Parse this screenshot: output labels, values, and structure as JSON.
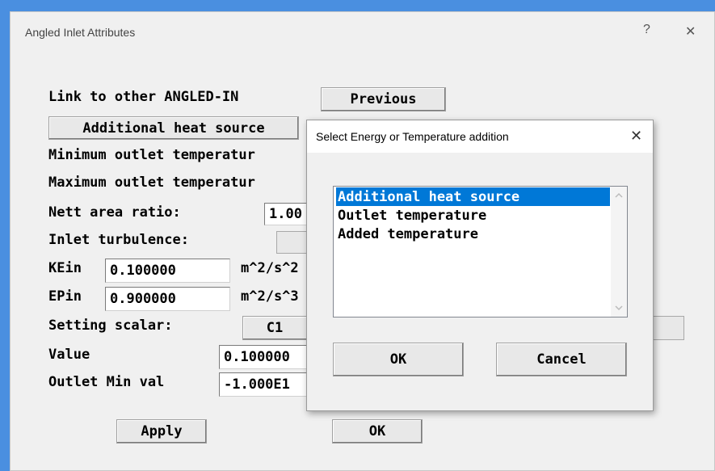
{
  "main_dialog": {
    "title": "Angled Inlet Attributes",
    "help_glyph": "?",
    "close_glyph": "✕",
    "link_label": "Link to other ANGLED-IN",
    "previous_button": "Previous",
    "heat_source_button": "Additional heat source",
    "min_outlet_label": "Minimum outlet temperatur",
    "max_outlet_label": "Maximum outlet temperatur",
    "nett_area_label": "Nett area ratio:",
    "nett_area_value": "1.00",
    "inlet_turbulence_label": "Inlet turbulence:",
    "kein_label": "KEin",
    "kein_value": "0.100000",
    "kein_unit": "m^2/s^2",
    "epin_label": "EPin",
    "epin_value": "0.900000",
    "epin_unit": "m^2/s^3",
    "setting_scalar_label": "Setting scalar:",
    "scalar_button": "C1",
    "value_label": "Value",
    "value_value": "0.100000",
    "outlet_min_label": "Outlet Min val",
    "outlet_min_value": "-1.000E1",
    "apply_button": "Apply",
    "ok_button": "OK"
  },
  "popup": {
    "title": "Select Energy or Temperature addition",
    "close_glyph": "✕",
    "options": [
      "Additional heat source",
      "Outlet temperature",
      "Added temperature"
    ],
    "selected_index": 0,
    "ok_button": "OK",
    "cancel_button": "Cancel"
  },
  "colors": {
    "accent": "#0078d7",
    "frame": "#4a8fe0",
    "window_bg": "#f0f0f0"
  }
}
